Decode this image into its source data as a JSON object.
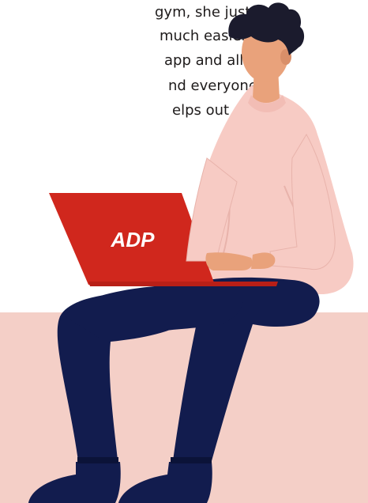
{
  "quote": {
    "lines": [
      "gym, she just sold",
      "much easier. I",
      "app and all",
      "nd everyone",
      "elps out a"
    ]
  },
  "laptop": {
    "logo_text": "ADP",
    "color": "#d0271d"
  },
  "colors": {
    "bench": "#f4cfc7",
    "shirt": "#f7cbc4",
    "pants": "#121c4e",
    "skin": "#e9a27b",
    "hair": "#1b1b2d"
  }
}
